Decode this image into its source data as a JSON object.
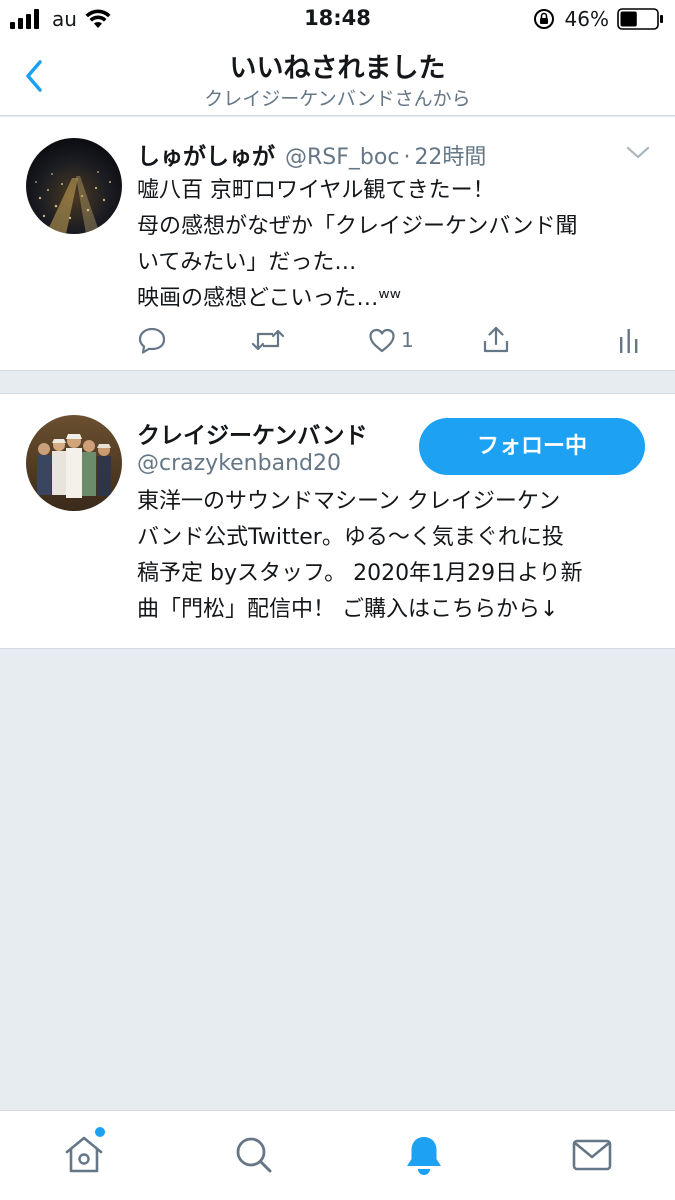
{
  "status_bar": {
    "carrier": "au",
    "time": "18:48",
    "battery_percent": "46%",
    "battery_level": 0.46
  },
  "nav": {
    "title": "いいねされました",
    "subtitle": "クレイジーケンバンドさんから",
    "accent_color": "#1da1f2"
  },
  "tweet": {
    "author_name": "しゅがしゅが",
    "author_handle": "@RSF_boc",
    "separator": "·",
    "time": "22時間",
    "lines": [
      "嘘八百 京町ロワイヤル観てきたー！",
      "母の感想がなぜか「クレイジーケンバンド聞",
      "いてみたい」だった…",
      "映画の感想どこいった…ʷʷ"
    ],
    "like_count": "1",
    "icons": [
      "reply-icon",
      "retweet-icon",
      "like-icon",
      "share-icon",
      "analytics-icon",
      "caret-down-icon"
    ]
  },
  "user_card": {
    "name": "クレイジーケンバンド",
    "handle": "@crazykenband20",
    "follow_label": "フォロー中",
    "bio_lines": [
      "東洋一のサウンドマシーン クレイジーケン",
      "バンド公式Twitter。ゆる〜く気まぐれに投",
      "稿予定 byスタッフ。 2020年1月29日より新",
      "曲「門松」配信中！ ご購入はこちらから↓"
    ]
  },
  "tab_bar": {
    "tabs": [
      "home-icon",
      "search-icon",
      "notifications-icon",
      "messages-icon"
    ],
    "active": "notifications-icon"
  }
}
